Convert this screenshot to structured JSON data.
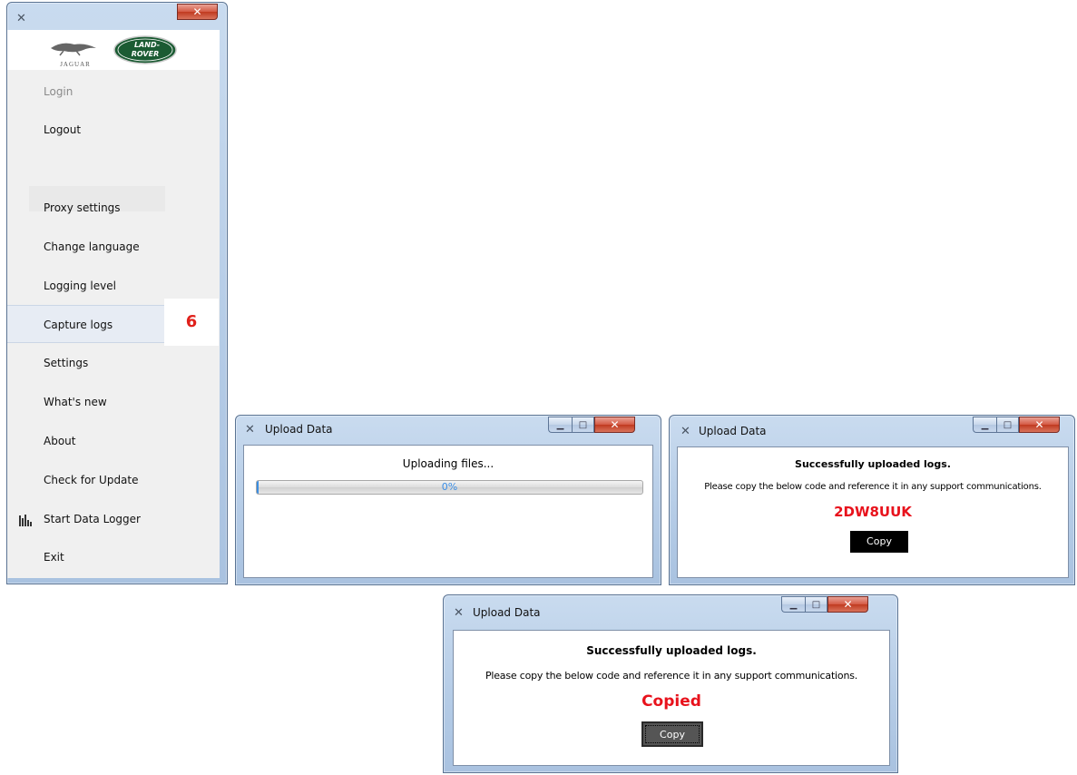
{
  "menu_window": {
    "close_glyph": "x",
    "logos": {
      "jaguar": "JAGUAR",
      "landrover": "LAND-\nROVER"
    },
    "items": [
      {
        "label": "Login",
        "state": "disabled"
      },
      {
        "label": "Logout",
        "state": "normal"
      },
      {
        "label": "Proxy settings",
        "state": "normal"
      },
      {
        "label": "Change language",
        "state": "normal"
      },
      {
        "label": "Logging level",
        "state": "normal"
      },
      {
        "label": "Capture logs",
        "state": "highlighted"
      },
      {
        "label": "Settings",
        "state": "normal"
      },
      {
        "label": "What's new",
        "state": "normal"
      },
      {
        "label": "About",
        "state": "normal"
      },
      {
        "label": "Check for Update",
        "state": "normal"
      },
      {
        "label": "Start Data Logger",
        "state": "normal",
        "icon": "bar-chart-icon"
      },
      {
        "label": "Exit",
        "state": "normal"
      }
    ],
    "step_number": "6"
  },
  "dialog_uploading": {
    "title": "Upload Data",
    "message": "Uploading files...",
    "progress_percent": 0,
    "progress_label": "0%"
  },
  "dialog_success": {
    "title": "Upload Data",
    "heading": "Successfully uploaded logs.",
    "instruction": "Please copy the below code and reference it in any support communications.",
    "code": "2DW8UUK",
    "copy_label": "Copy"
  },
  "dialog_copied": {
    "title": "Upload Data",
    "heading": "Successfully uploaded logs.",
    "instruction": "Please copy the below code and reference it in any support communications.",
    "code": "Copied",
    "copy_label": "Copy"
  },
  "colors": {
    "accent_red": "#e8121c",
    "progress_blue": "#3b8de0",
    "landrover_green": "#1b5b33"
  }
}
